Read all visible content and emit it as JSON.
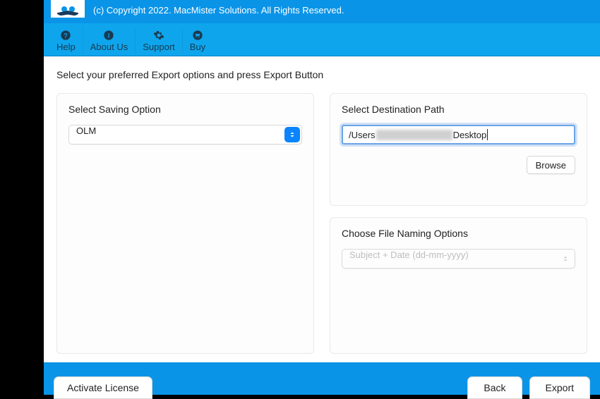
{
  "header": {
    "copyright": "(c) Copyright 2022. MacMister Solutions. All Rights Reserved."
  },
  "toolbar": {
    "help": "Help",
    "about": "About Us",
    "support": "Support",
    "buy": "Buy"
  },
  "instruction": "Select your preferred Export options and press Export Button",
  "saving": {
    "title": "Select Saving Option",
    "value": "OLM"
  },
  "destination": {
    "title": "Select Destination Path",
    "path_prefix": "/Users",
    "path_suffix": "Desktop",
    "browse": "Browse"
  },
  "naming": {
    "title": "Choose File Naming Options",
    "placeholder": "Subject + Date (dd-mm-yyyy)"
  },
  "footer": {
    "activate": "Activate License",
    "back": "Back",
    "export": "Export"
  }
}
